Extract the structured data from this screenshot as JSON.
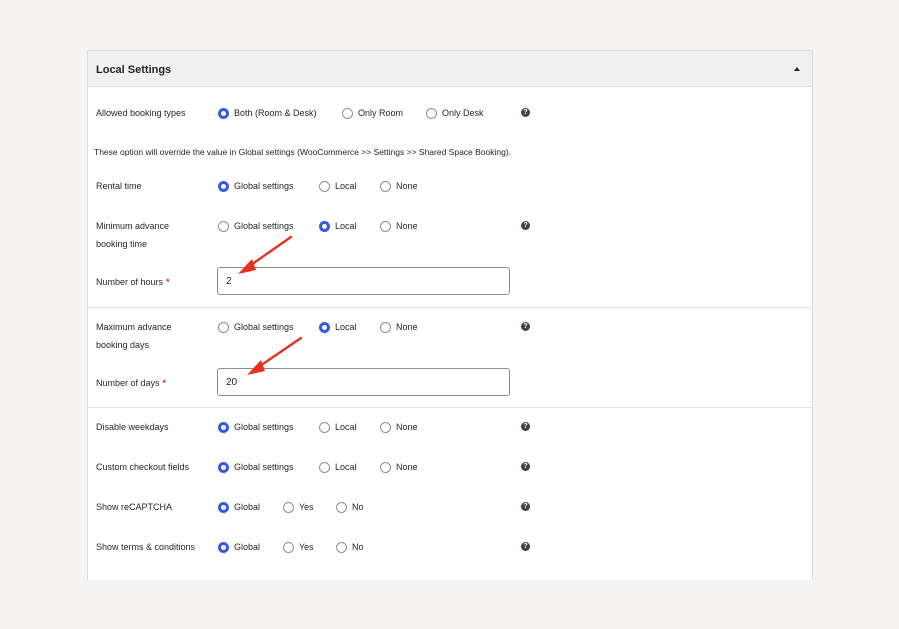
{
  "panel": {
    "title": "Local Settings",
    "note": "These option will override the value in Global settings (WooCommerce >> Settings >> Shared Space Booking)."
  },
  "rows": {
    "booking_types": {
      "label": "Allowed booking types",
      "options": [
        "Both (Room & Desk)",
        "Only Room",
        "Only Desk"
      ],
      "selected": 0
    },
    "rental_time": {
      "label": "Rental time",
      "options": [
        "Global settings",
        "Local",
        "None"
      ],
      "selected": 0
    },
    "min_advance": {
      "label": "Minimum advance booking time",
      "options": [
        "Global settings",
        "Local",
        "None"
      ],
      "selected": 1,
      "field_label": "Number of hours",
      "field_value": "2"
    },
    "max_advance": {
      "label": "Maximum advance booking days",
      "options": [
        "Global settings",
        "Local",
        "None"
      ],
      "selected": 1,
      "field_label": "Number of days",
      "field_value": "20"
    },
    "disable_weekdays": {
      "label": "Disable weekdays",
      "options": [
        "Global settings",
        "Local",
        "None"
      ],
      "selected": 0
    },
    "custom_checkout": {
      "label": "Custom checkout fields",
      "options": [
        "Global settings",
        "Local",
        "None"
      ],
      "selected": 0
    },
    "recaptcha": {
      "label": "Show reCAPTCHA",
      "options": [
        "Global",
        "Yes",
        "No"
      ],
      "selected": 0
    },
    "terms": {
      "label": "Show terms & conditions",
      "options": [
        "Global",
        "Yes",
        "No"
      ],
      "selected": 0
    }
  },
  "icons": {
    "help": "question-circle-icon",
    "collapse": "triangle-up-icon",
    "annotation": "red-arrow"
  },
  "colors": {
    "accent": "#3858e9",
    "required": "#d63638",
    "arrow": "#e8311d"
  }
}
